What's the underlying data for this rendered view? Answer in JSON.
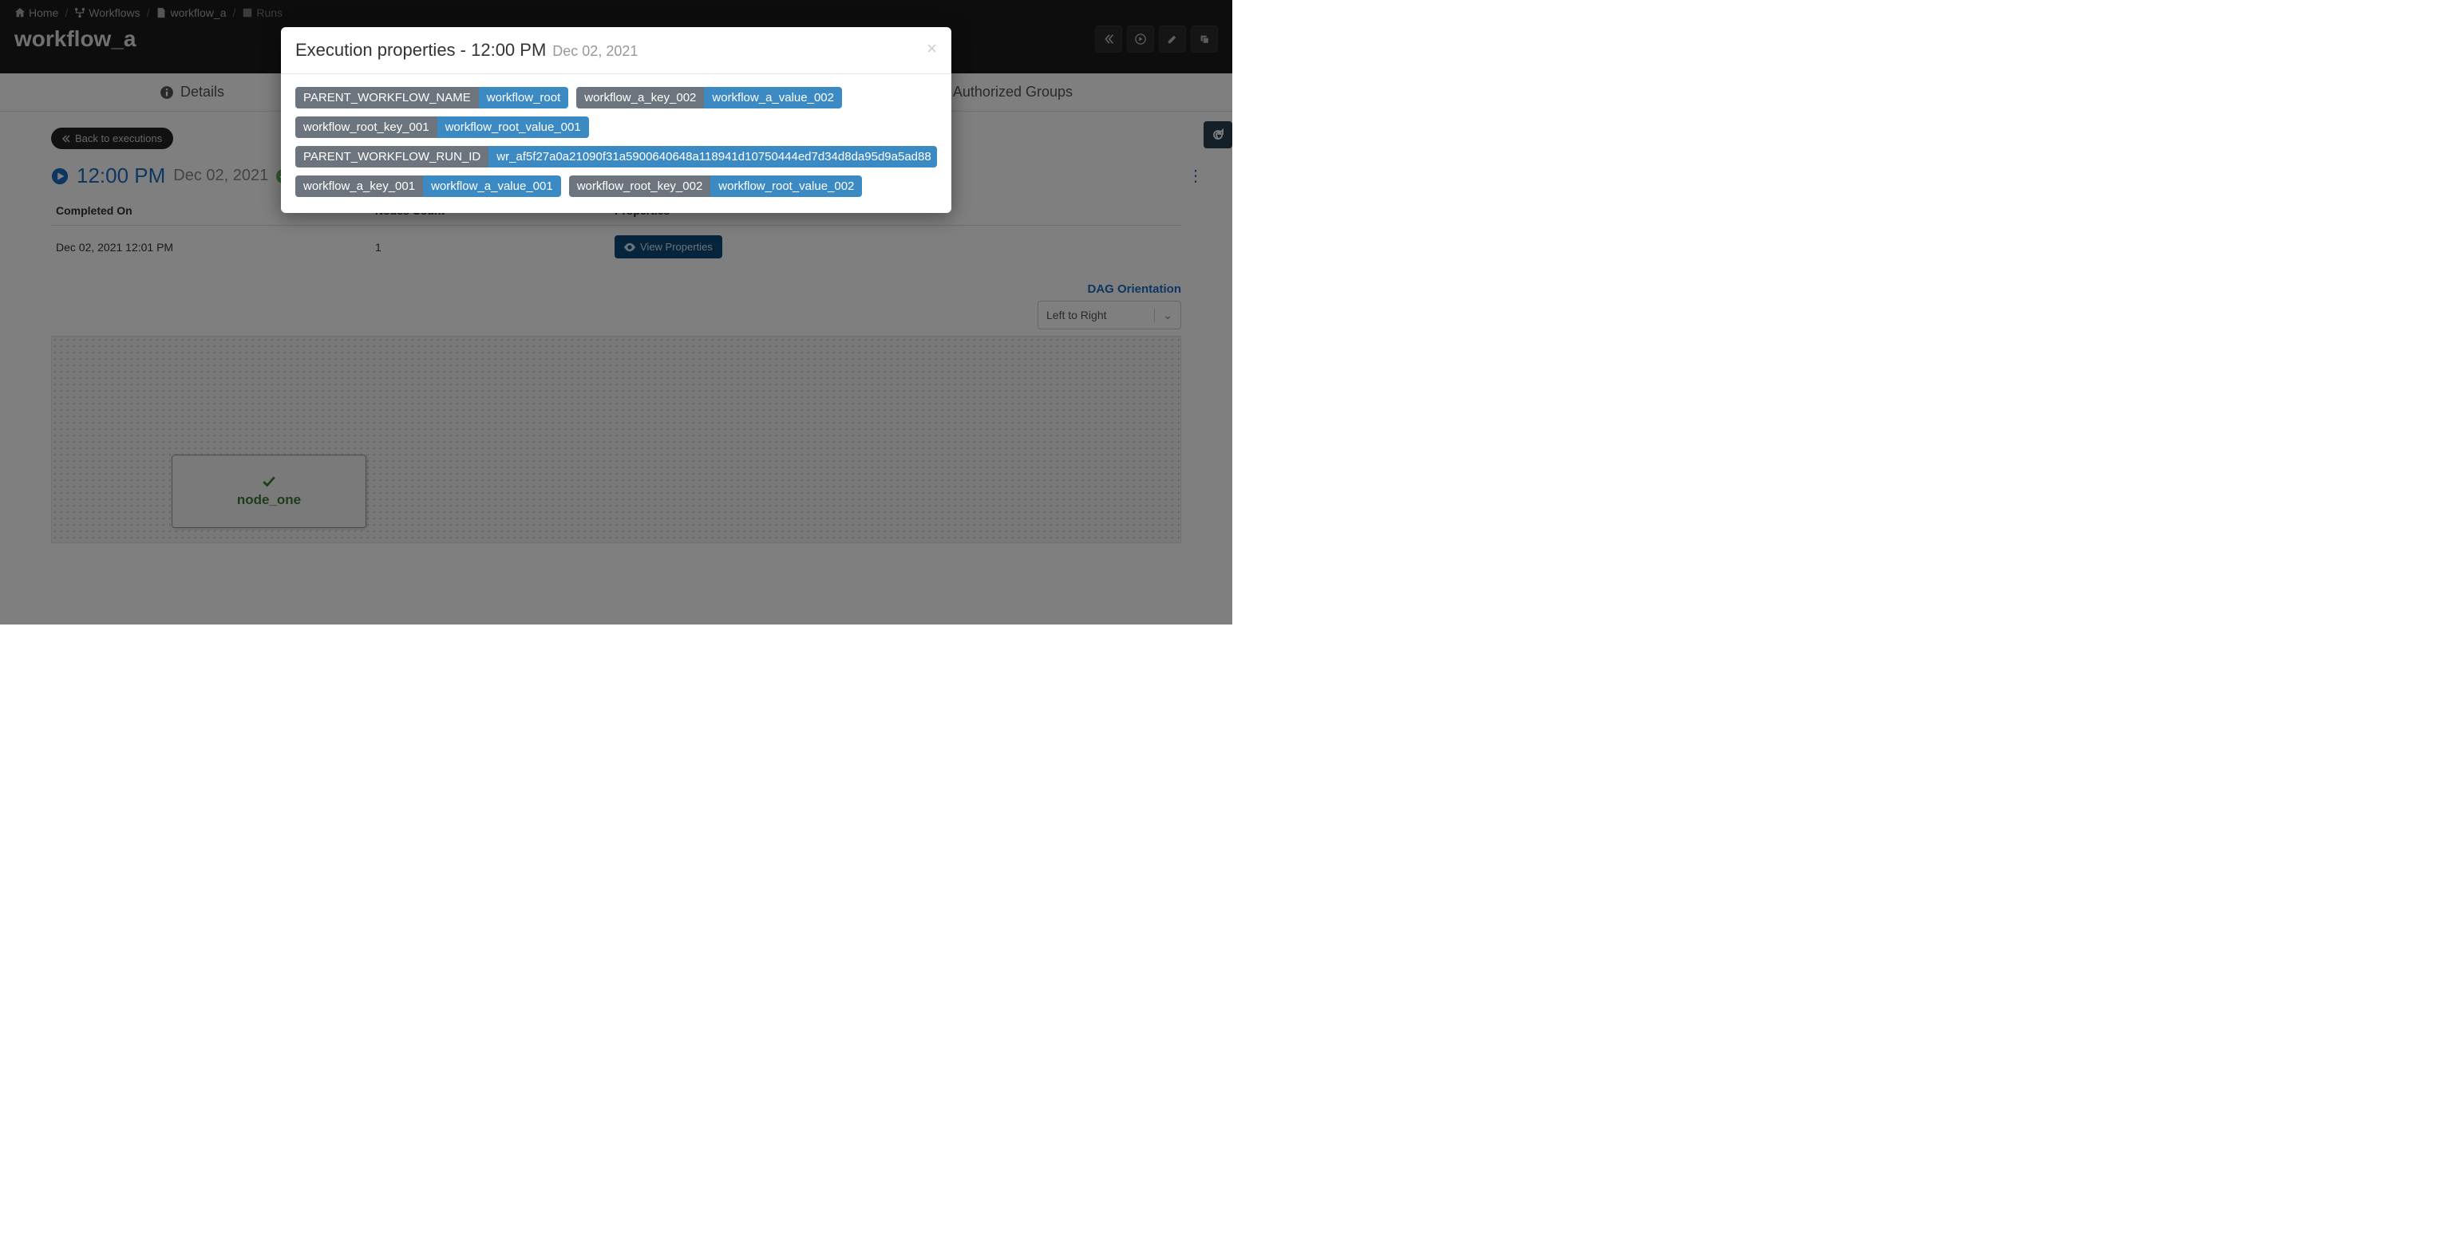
{
  "breadcrumb": {
    "home": "Home",
    "workflows": "Workflows",
    "workflow": "workflow_a",
    "runs": "Runs"
  },
  "page": {
    "title": "workflow_a"
  },
  "tabs": {
    "details": "Details",
    "authorized_groups": "Authorized Groups"
  },
  "actions": {
    "back_to_executions": "Back to executions"
  },
  "execution": {
    "time": "12:00 PM",
    "date": "Dec 02, 2021",
    "columns": {
      "completed_on": "Completed On",
      "nodes_count": "Nodes Count",
      "properties": "Properties"
    },
    "row": {
      "completed_on": "Dec 02, 2021 12:01 PM",
      "nodes_count": "1",
      "view_properties_label": "View Properties"
    }
  },
  "dag": {
    "orientation_label": "DAG Orientation",
    "orientation_value": "Left to Right",
    "node_label": "node_one"
  },
  "modal": {
    "title": "Execution properties - 12:00 PM",
    "subtitle": "Dec 02, 2021",
    "properties": [
      {
        "key": "PARENT_WORKFLOW_NAME",
        "value": "workflow_root"
      },
      {
        "key": "workflow_a_key_002",
        "value": "workflow_a_value_002"
      },
      {
        "key": "workflow_root_key_001",
        "value": "workflow_root_value_001"
      },
      {
        "key": "PARENT_WORKFLOW_RUN_ID",
        "value": "wr_af5f27a0a21090f31a5900640648a118941d10750444ed7d34d8da95d9a5ad88"
      },
      {
        "key": "workflow_a_key_001",
        "value": "workflow_a_value_001"
      },
      {
        "key": "workflow_root_key_002",
        "value": "workflow_root_value_002"
      }
    ]
  }
}
